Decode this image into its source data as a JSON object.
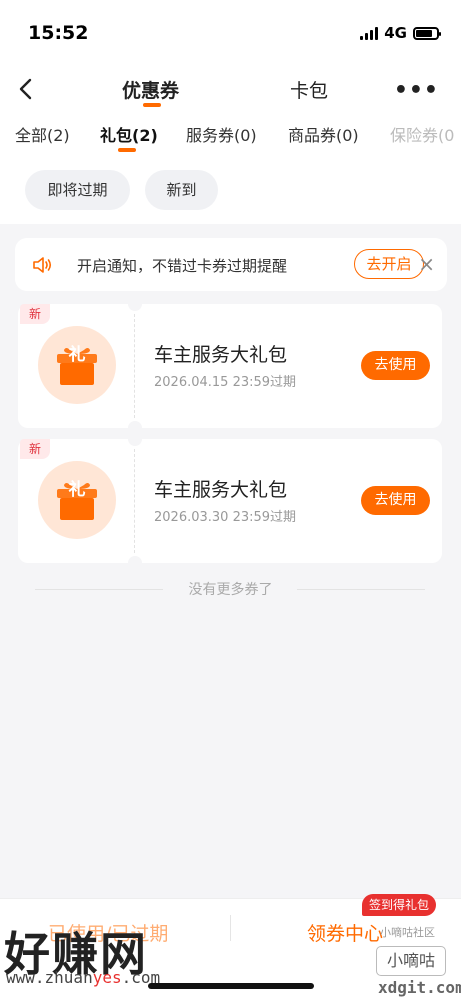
{
  "status_bar": {
    "time": "15:52",
    "network": "4G"
  },
  "nav": {
    "tabs": [
      {
        "label": "优惠券"
      },
      {
        "label": "卡包"
      }
    ],
    "more_label": "•••"
  },
  "categories": [
    {
      "label": "全部(2)"
    },
    {
      "label": "礼包(2)"
    },
    {
      "label": "服务券(0)"
    },
    {
      "label": "商品券(0)"
    },
    {
      "label": "保险券(0"
    }
  ],
  "filters": [
    {
      "label": "即将过期"
    },
    {
      "label": "新到"
    }
  ],
  "notice": {
    "text": "开启通知，不错过卡券过期提醒",
    "button_label": "去开启",
    "close_label": "×"
  },
  "coupons": [
    {
      "tag": "新",
      "icon_char": "礼",
      "title": "车主服务大礼包",
      "expiry": "2026.04.15 23:59过期",
      "button_label": "去使用"
    },
    {
      "tag": "新",
      "icon_char": "礼",
      "title": "车主服务大礼包",
      "expiry": "2026.03.30 23:59过期",
      "button_label": "去使用"
    }
  ],
  "no_more_text": "没有更多券了",
  "bottom": {
    "left_label": "已使用/已过期",
    "right_label": "领券中心",
    "badge": "签到得礼包"
  },
  "watermarks": {
    "left_text": "好赚网",
    "left_url_1": "www.zhuan",
    "left_url_2": "yes",
    "left_url_3": ".com",
    "right_small": "小嘀咕社区",
    "right_box": "小嘀咕",
    "right_url": "xdgit.com"
  },
  "colors": {
    "accent": "#ff6a00",
    "new_tag": "#e0323d",
    "badge": "#e8312f"
  }
}
